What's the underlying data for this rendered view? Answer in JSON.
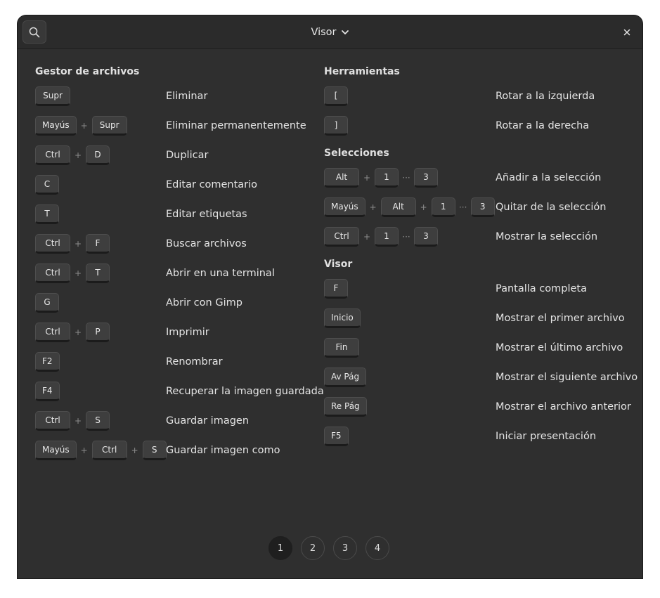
{
  "header": {
    "title": "Visor",
    "search_icon": "search-icon",
    "close_icon": "close-icon"
  },
  "left": {
    "title": "Gestor de archivos",
    "rows": [
      {
        "keys": [
          "Supr"
        ],
        "desc": "Eliminar"
      },
      {
        "keys": [
          "Mayús",
          "+",
          "Supr"
        ],
        "desc": "Eliminar permanentemente"
      },
      {
        "keys": [
          "Ctrl",
          "+",
          "D"
        ],
        "desc": "Duplicar"
      },
      {
        "keys": [
          "C"
        ],
        "desc": "Editar comentario"
      },
      {
        "keys": [
          "T"
        ],
        "desc": "Editar etiquetas"
      },
      {
        "keys": [
          "Ctrl",
          "+",
          "F"
        ],
        "desc": "Buscar archivos"
      },
      {
        "keys": [
          "Ctrl",
          "+",
          "T"
        ],
        "desc": "Abrir en una terminal"
      },
      {
        "keys": [
          "G"
        ],
        "desc": "Abrir con Gimp"
      },
      {
        "keys": [
          "Ctrl",
          "+",
          "P"
        ],
        "desc": "Imprimir"
      },
      {
        "keys": [
          "F2"
        ],
        "desc": "Renombrar"
      },
      {
        "keys": [
          "F4"
        ],
        "desc": "Recuperar la imagen guardada"
      },
      {
        "keys": [
          "Ctrl",
          "+",
          "S"
        ],
        "desc": "Guardar imagen"
      },
      {
        "keys": [
          "Mayús",
          "+",
          "Ctrl",
          "+",
          "S"
        ],
        "desc": "Guardar imagen como"
      }
    ]
  },
  "right": {
    "sections": [
      {
        "title": "Herramientas",
        "rows": [
          {
            "keys": [
              "["
            ],
            "desc": "Rotar a la izquierda"
          },
          {
            "keys": [
              "]"
            ],
            "desc": "Rotar a la derecha"
          }
        ]
      },
      {
        "title": "Selecciones",
        "rows": [
          {
            "keys": [
              "Alt",
              "+",
              "1",
              "···",
              "3"
            ],
            "desc": "Añadir a la selección"
          },
          {
            "keys": [
              "Mayús",
              "+",
              "Alt",
              "+",
              "1",
              "···",
              "3"
            ],
            "desc": "Quitar de la selección"
          },
          {
            "keys": [
              "Ctrl",
              "+",
              "1",
              "···",
              "3"
            ],
            "desc": "Mostrar la selección"
          }
        ]
      },
      {
        "title": "Visor",
        "rows": [
          {
            "keys": [
              "F"
            ],
            "desc": "Pantalla completa"
          },
          {
            "keys": [
              "Inicio"
            ],
            "desc": "Mostrar el primer archivo"
          },
          {
            "keys": [
              "Fin"
            ],
            "desc": "Mostrar el último archivo"
          },
          {
            "keys": [
              "Av Pág"
            ],
            "desc": "Mostrar el siguiente archivo"
          },
          {
            "keys": [
              "Re Pág"
            ],
            "desc": "Mostrar el archivo anterior"
          },
          {
            "keys": [
              "F5"
            ],
            "desc": "Iniciar presentación"
          }
        ]
      }
    ]
  },
  "pagination": {
    "pages": [
      "1",
      "2",
      "3",
      "4"
    ],
    "active": "1"
  }
}
